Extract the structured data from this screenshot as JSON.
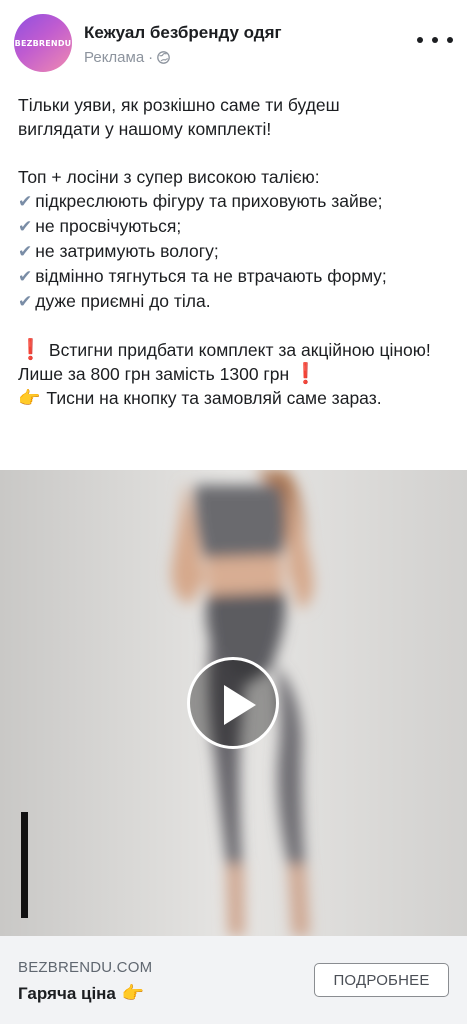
{
  "header": {
    "avatar_text": "BEZBRENDU",
    "page_name": "Кежуал безбренду одяг",
    "sponsored_label": "Реклама",
    "separator": "·"
  },
  "post": {
    "intro_line1": "Тільки уяви, як розкішно саме ти будеш",
    "intro_line2": "виглядати у нашому комплекті!",
    "subtitle": "Топ + лосіни з супер високою талією:",
    "check_glyph": "✔",
    "bullets": [
      "підкреслюють фігуру та приховують зайве;",
      "не просвічуються;",
      "не затримують вологу;",
      "відмінно тягнуться та не втрачають формy;",
      "дуже приємні до тіла."
    ],
    "promo_prefix": "❗",
    "promo_text": "Встигни придбати комплект за акційною ціною! Лише за 800 грн замість 1300 грн",
    "promo_suffix": "❗",
    "cta_emoji": "👉",
    "cta_text": "Тисни на кнопку та замовляй саме зараз."
  },
  "video": {
    "state": "paused"
  },
  "link_preview": {
    "domain": "BEZBRENDU.COM",
    "headline": "Гаряча ціна",
    "headline_emoji": "👉",
    "button_label": "ПОДРОБНЕЕ"
  },
  "colors": {
    "text": "#1c1e21",
    "secondary": "#8d949e",
    "alert": "#e0245e",
    "cta_bar": "#f2f3f5"
  }
}
